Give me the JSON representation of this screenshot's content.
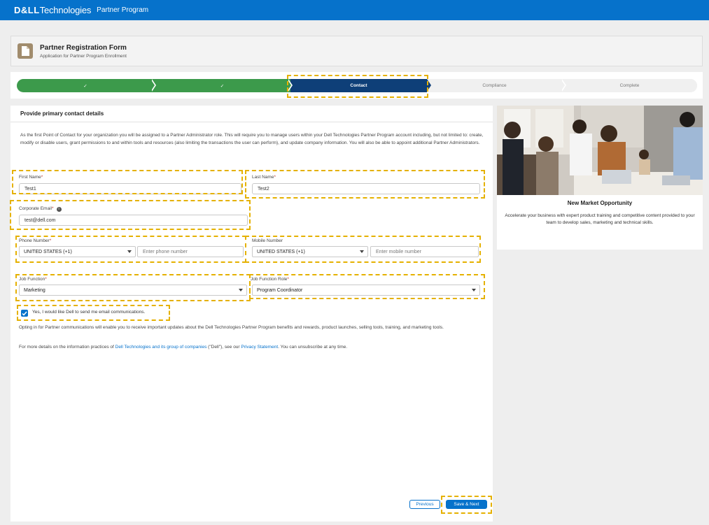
{
  "brand": {
    "logo_bold": "D&LL",
    "logo_text": "Technologies",
    "program": "Partner Program",
    "bar_color": "#0672cb",
    "accent": "#0672cb",
    "highlight": "#e5b100"
  },
  "header": {
    "icon": "document-icon",
    "title": "Partner Registration Form",
    "subtitle": "Application for Partner Program Enrollment"
  },
  "progress": {
    "steps": [
      {
        "label": "✓",
        "state": "done"
      },
      {
        "label": "✓",
        "state": "done"
      },
      {
        "label": "Contact",
        "state": "active"
      },
      {
        "label": "Compliance",
        "state": "todo"
      },
      {
        "label": "Complete",
        "state": "todo"
      }
    ]
  },
  "form": {
    "section_title": "Provide primary contact details",
    "intro": "As the first Point of Contact for your organization you will be assigned to a Partner Administrator role. This will require you to manage users within your Dell Technologies Partner Program account including, but not limited to: create, modify or disable users, grant permissions to and within tools and resources (also limiting the transactions the user can perform), and update company information. You will also be able to appoint additional Partner Administrators.",
    "first_name": {
      "label": "First Name",
      "required": "*",
      "value": "Test1"
    },
    "last_name": {
      "label": "Last Name",
      "required": "*",
      "value": "Test2"
    },
    "corporate_email": {
      "label": "Corporate Email",
      "required": "*",
      "value": "test@dell.com"
    },
    "phone": {
      "label": "Phone Number",
      "required": "*",
      "country": "UNITED STATES (+1)",
      "placeholder": "Enter phone number"
    },
    "mobile": {
      "label": "Mobile Number",
      "country": "UNITED STATES (+1)",
      "placeholder": "Enter mobile number"
    },
    "job_function": {
      "label": "Job Function",
      "required": "*",
      "value": "Marketing"
    },
    "job_function_role": {
      "label": "Job Function Role",
      "required": "*",
      "value": "Program Coordinator"
    },
    "opt_in": {
      "label": "Yes, I would like Dell to send me email communications.",
      "checked": true
    },
    "opt_in_text": "Opting in for Partner communications will enable you to receive important updates about the Dell Technologies Partner Program benefits and rewards, product launches, selling tools, training, and marketing tools.",
    "privacy": {
      "prefix": "For more details on the information practices of ",
      "link1": "Dell Technologies and its group of companies",
      "middle": " (\"Dell\"), see our ",
      "link2": "Privacy Statement",
      "suffix": ". You can unsubscribe at any time."
    },
    "previous_label": "Previous",
    "next_label": "Save & Next"
  },
  "promo": {
    "title": "New Market Opportunity",
    "text": "Accelerate your business with expert product training and competitive content provided to your team to develop sales, marketing and technical skills."
  }
}
